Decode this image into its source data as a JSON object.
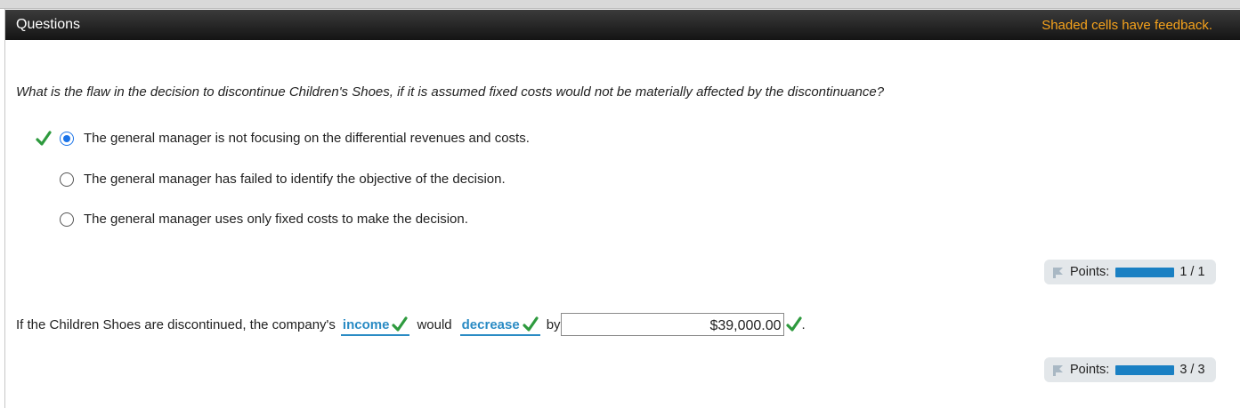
{
  "header": {
    "title": "Questions",
    "feedback_note": "Shaded cells have feedback."
  },
  "question1": {
    "prompt": "What is the flaw in the decision to discontinue Children's Shoes, if it is assumed fixed costs would not be materially affected by the discontinuance?",
    "options": [
      {
        "label": "The general manager is not focusing on the differential revenues and costs.",
        "selected": true,
        "correct_mark": true
      },
      {
        "label": "The general manager has failed to identify the objective of the decision.",
        "selected": false,
        "correct_mark": false
      },
      {
        "label": "The general manager uses only fixed costs to make the decision.",
        "selected": false,
        "correct_mark": false
      }
    ],
    "points": {
      "label": "Points:",
      "score": "1 / 1",
      "progress": 1.0
    }
  },
  "question2": {
    "text_before": "If the Children Shoes are discontinued, the company's",
    "answer1": "income",
    "text_middle": "would",
    "answer2": "decrease",
    "text_by": "by",
    "amount": "$39,000.00",
    "text_end": ".",
    "points": {
      "label": "Points:",
      "score": "3 / 3",
      "progress": 1.0
    }
  },
  "colors": {
    "header_bg": "#1f1f1f",
    "feedback_text": "#f5a21c",
    "correct_check": "#2e9a3e",
    "answer_blue": "#2a8bc4",
    "progress_blue": "#1a80c3",
    "radio_selected": "#1a73e8"
  },
  "icons": [
    "check-mark-icon",
    "flag-icon"
  ]
}
